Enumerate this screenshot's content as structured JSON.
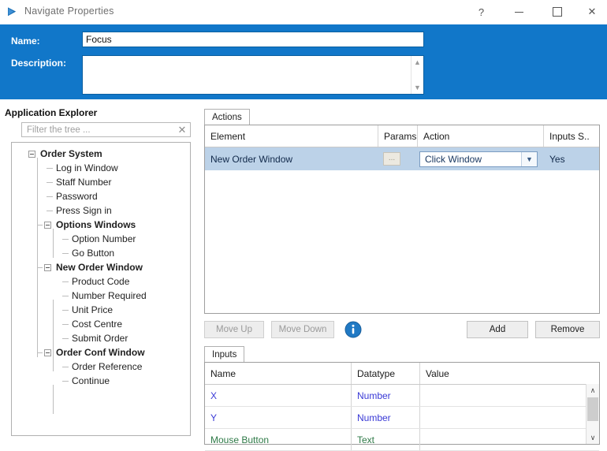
{
  "window": {
    "title": "Navigate Properties",
    "icon": "navigate-play-icon",
    "controls": {
      "help": "?",
      "minimize": "–",
      "maximize": "□",
      "close": "✕"
    },
    "accent_color": "#1177c9"
  },
  "header": {
    "name_label": "Name:",
    "name_value": "Focus",
    "description_label": "Description:",
    "description_value": "",
    "description_placeholder": ""
  },
  "explorer": {
    "title": "Application Explorer",
    "filter_placeholder": "Filter the tree ...",
    "filter_value": "",
    "clear_icon": "✕",
    "tree": [
      {
        "label": "Order System",
        "level": 0,
        "bold": true,
        "expander": "minus"
      },
      {
        "label": "Log in Window",
        "level": 1,
        "bold": false,
        "expander": "none"
      },
      {
        "label": "Staff Number",
        "level": 1,
        "bold": false,
        "expander": "none"
      },
      {
        "label": "Password",
        "level": 1,
        "bold": false,
        "expander": "none"
      },
      {
        "label": "Press Sign in",
        "level": 1,
        "bold": false,
        "expander": "none"
      },
      {
        "label": "Options Windows",
        "level": 1,
        "bold": true,
        "expander": "minus"
      },
      {
        "label": "Option Number",
        "level": 2,
        "bold": false,
        "expander": "none"
      },
      {
        "label": "Go Button",
        "level": 2,
        "bold": false,
        "expander": "none"
      },
      {
        "label": "New Order Window",
        "level": 1,
        "bold": true,
        "expander": "minus"
      },
      {
        "label": "Product Code",
        "level": 2,
        "bold": false,
        "expander": "none"
      },
      {
        "label": "Number Required",
        "level": 2,
        "bold": false,
        "expander": "none"
      },
      {
        "label": "Unit Price",
        "level": 2,
        "bold": false,
        "expander": "none"
      },
      {
        "label": "Cost Centre",
        "level": 2,
        "bold": false,
        "expander": "none"
      },
      {
        "label": "Submit Order",
        "level": 2,
        "bold": false,
        "expander": "none"
      },
      {
        "label": "Order Conf Window",
        "level": 1,
        "bold": true,
        "expander": "minus"
      },
      {
        "label": "Order Reference",
        "level": 2,
        "bold": false,
        "expander": "none"
      },
      {
        "label": "Continue",
        "level": 2,
        "bold": false,
        "expander": "none"
      }
    ]
  },
  "actions": {
    "tab_label": "Actions",
    "columns": [
      "Element",
      "Params",
      "Action",
      "Inputs S.."
    ],
    "rows": [
      {
        "element": "New Order Window",
        "params": "...",
        "action": "Click Window",
        "inputs_supplied": "Yes",
        "selected": true
      }
    ]
  },
  "toolbar": {
    "move_up": "Move Up",
    "move_down": "Move Down",
    "move_up_disabled": true,
    "move_down_disabled": true,
    "info_icon": "info-circle-icon",
    "add": "Add",
    "remove": "Remove"
  },
  "inputs": {
    "tab_label": "Inputs",
    "columns": [
      "Name",
      "Datatype",
      "Value"
    ],
    "rows": [
      {
        "name": "X",
        "datatype": "Number",
        "value": "",
        "color": "blue"
      },
      {
        "name": "Y",
        "datatype": "Number",
        "value": "",
        "color": "blue"
      },
      {
        "name": "Mouse Button",
        "datatype": "Text",
        "value": "",
        "color": "green"
      }
    ],
    "scrollbar": {
      "up": "∧",
      "down": "∨"
    }
  }
}
